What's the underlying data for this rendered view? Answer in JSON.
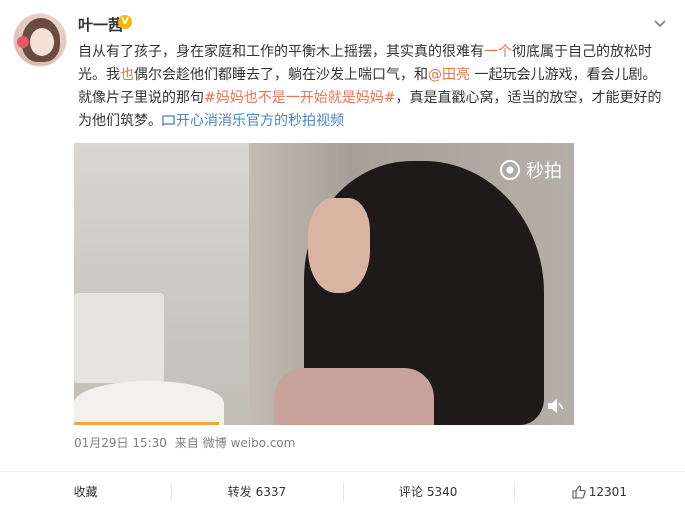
{
  "user": {
    "name": "叶一茜",
    "verified_badge": "V"
  },
  "post": {
    "text_parts": [
      {
        "text": "自从有了孩子，身在家庭和工作的平衡木上摇摆，其实真的很难有",
        "style": "normal"
      },
      {
        "text": "一个",
        "style": "hl"
      },
      {
        "text": "彻底属于自己的放松时光。我",
        "style": "normal"
      },
      {
        "text": "也",
        "style": "hl"
      },
      {
        "text": "偶尔会趁他们都睡去了，躺在沙发上喘口气，和",
        "style": "normal"
      },
      {
        "text": "@田亮",
        "style": "user"
      },
      {
        "text": " 一起玩会儿游戏，看会儿剧。就像片子里说的那句",
        "style": "normal"
      },
      {
        "text": "#妈妈也不是一开始就是妈妈#",
        "style": "link"
      },
      {
        "text": "，真是直戳心窝，适当的放空，才能更好的为他们筑梦。",
        "style": "normal"
      },
      {
        "text": "开心消消乐官方的秒拍视频",
        "style": "source"
      }
    ]
  },
  "video": {
    "watermark": "秒拍",
    "progress": 0.29
  },
  "meta": {
    "date": "01月29日 15:30",
    "from_label": "来自",
    "source": "微博 weibo.com"
  },
  "actions": {
    "favorite": "收藏",
    "repost_label": "转发",
    "repost_count": "6337",
    "comment_label": "评论",
    "comment_count": "5340",
    "like_count": "12301"
  },
  "colors": {
    "link": "#eb7350",
    "source": "#4a86c5",
    "badge": "#f7b500"
  }
}
